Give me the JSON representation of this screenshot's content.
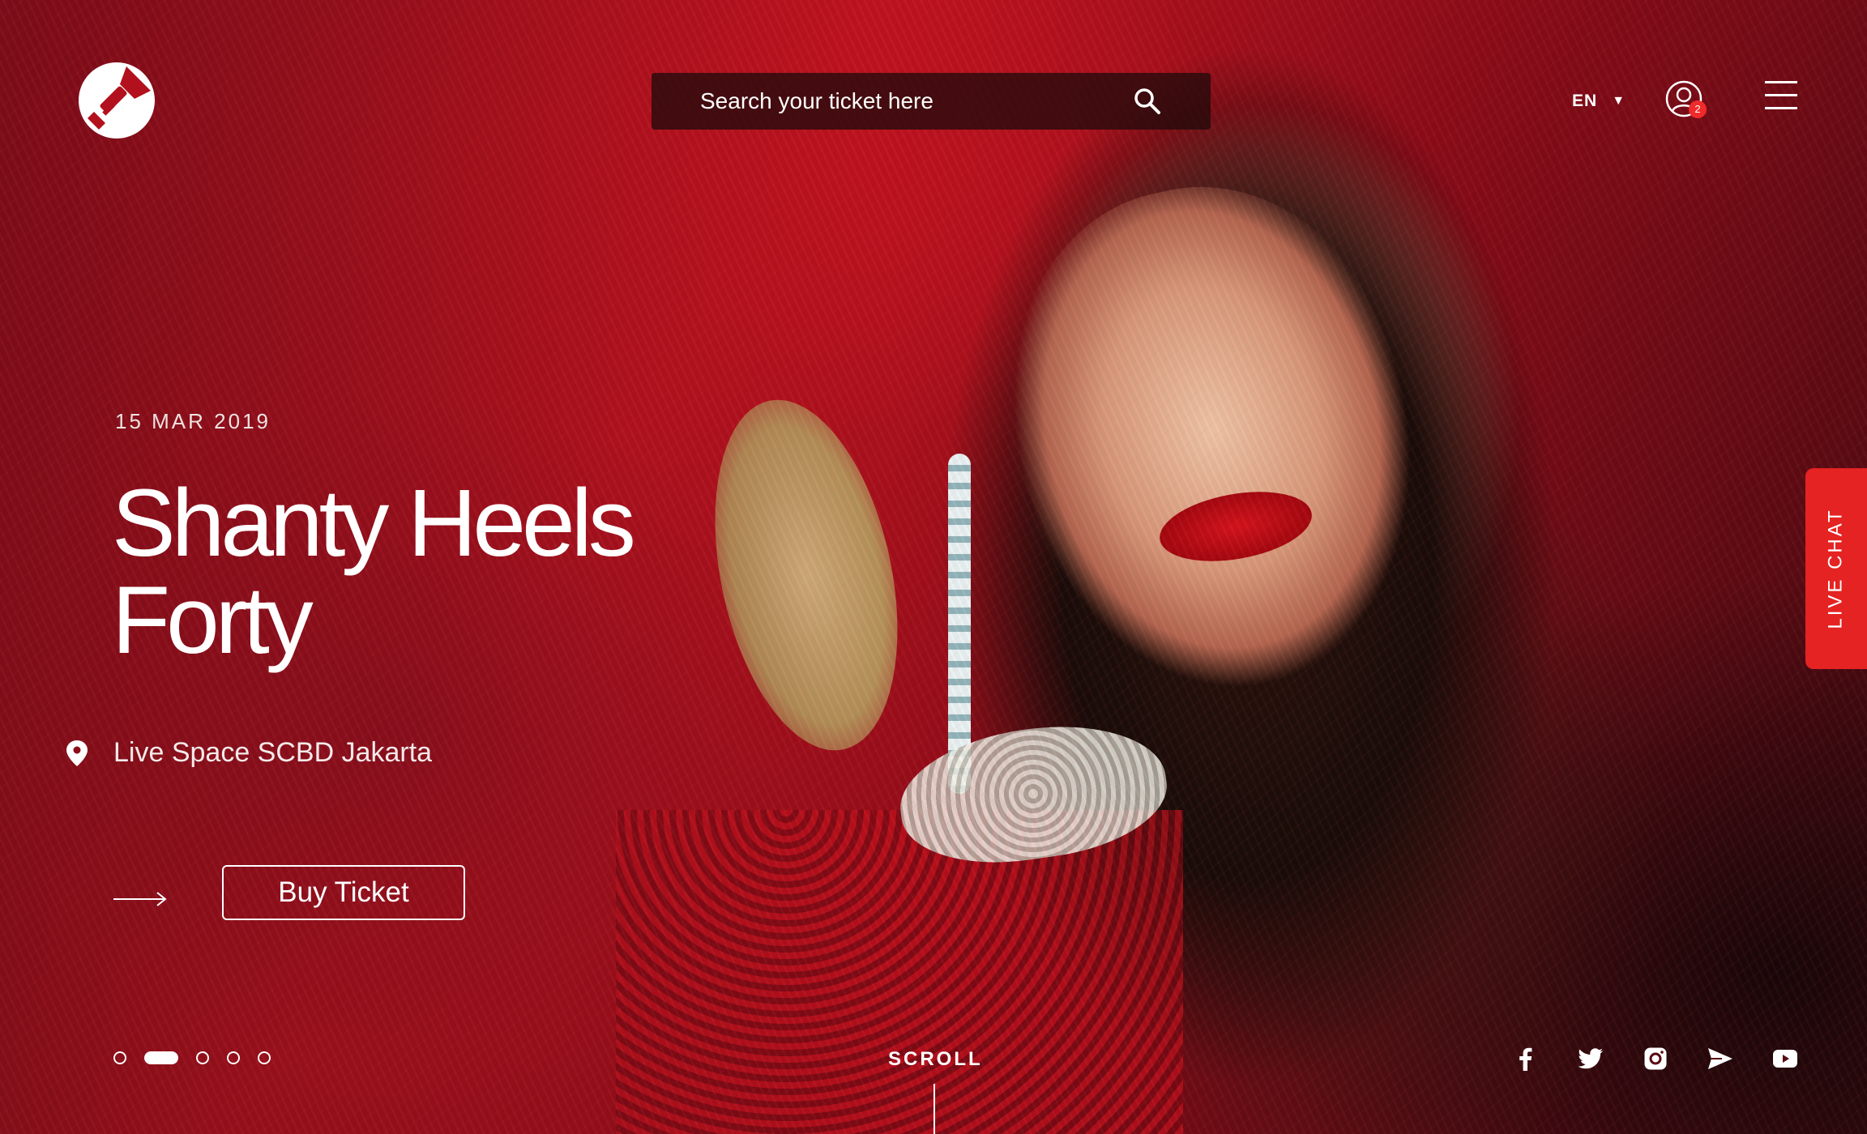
{
  "header": {
    "search_placeholder": "Search your ticket here",
    "language": "EN",
    "notification_count": "2"
  },
  "event": {
    "date": "15 MAR 2019",
    "title_line1": "Shanty Heels",
    "title_line2": "Forty",
    "venue": "Live Space SCBD Jakarta",
    "buy_label": "Buy Ticket"
  },
  "slider": {
    "slide_count": 5,
    "active_index": 1
  },
  "footer": {
    "scroll_label": "SCROLL",
    "social_icons": [
      "facebook-icon",
      "twitter-icon",
      "instagram-icon",
      "send-icon",
      "youtube-icon"
    ]
  },
  "live_chat_label": "LIVE CHAT",
  "colors": {
    "accent": "#e52323",
    "hero_red": "#c0131f"
  }
}
